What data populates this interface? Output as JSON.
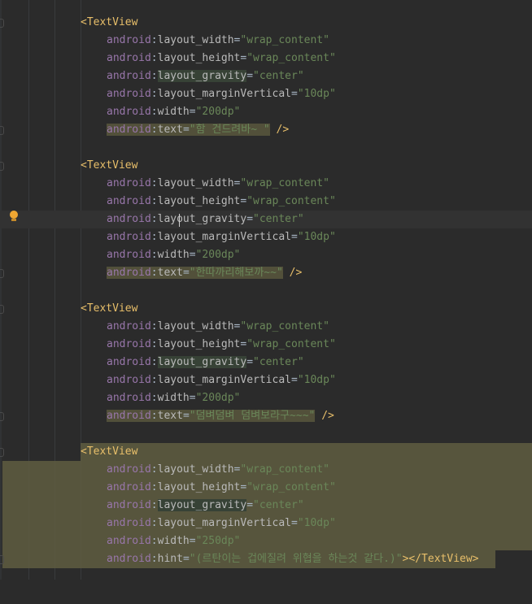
{
  "editor": {
    "blocks": [
      {
        "open_tag": "<TextView",
        "width_value": "\"200dp\"",
        "text_attr": "text",
        "text_value": "\"함 건드려바~ \"",
        "closer": " />"
      },
      {
        "open_tag": "<TextView",
        "width_value": "\"200dp\"",
        "text_attr": "text",
        "text_value": "\"한따까리해보까~~\"",
        "closer": " />"
      },
      {
        "open_tag": "<TextView",
        "width_value": "\"200dp\"",
        "text_attr": "text",
        "text_value": "\"덤벼덤벼 덤벼보라구~~~\"",
        "closer": " />"
      },
      {
        "open_tag": "<TextView",
        "width_value": "\"250dp\"",
        "text_attr": "hint",
        "text_value": "\"(르탄이는 겁에질려 위협을 하는것 같다.)\"",
        "closer": "></TextView>"
      }
    ],
    "tokens": {
      "ns": "android",
      "colon": ":",
      "eq": "=",
      "layout_width": "layout_width",
      "layout_height": "layout_height",
      "layout_gravity": "layout_gravity",
      "layout_gravity_a": "lay",
      "layout_gravity_b": "out_gravity",
      "layout_marginVertical": "layout_marginVertical",
      "width": "width",
      "wrap_content": "\"wrap_content\"",
      "center": "\"center\"",
      "margin_value": "\"10dp\""
    },
    "colors": {
      "background": "#2b2b2b",
      "namespace": "#9876aa",
      "attribute": "#bababa",
      "string": "#6a8759",
      "tag": "#e8bf6a",
      "selection": "#5f5d41",
      "bulb": "#f0a732"
    },
    "icons": {
      "intention": "lightbulb-icon"
    }
  }
}
